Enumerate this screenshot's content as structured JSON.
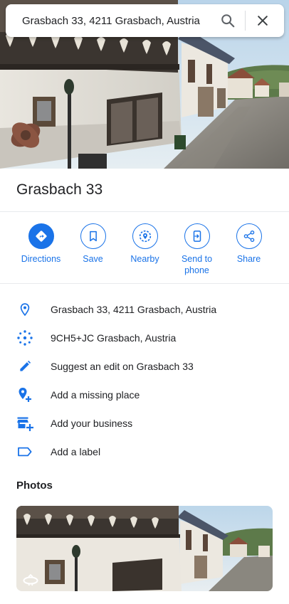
{
  "search": {
    "value": "Grasbach 33, 4211 Grasbach, Austria",
    "search_icon": "search-icon",
    "close_icon": "close-icon"
  },
  "place": {
    "title": "Grasbach 33"
  },
  "actions": [
    {
      "label": "Directions",
      "icon": "directions-icon"
    },
    {
      "label": "Save",
      "icon": "bookmark-icon"
    },
    {
      "label": "Nearby",
      "icon": "nearby-icon"
    },
    {
      "label": "Send to phone",
      "icon": "send-to-phone-icon"
    },
    {
      "label": "Share",
      "icon": "share-icon"
    }
  ],
  "info": [
    {
      "text": "Grasbach 33, 4211 Grasbach, Austria",
      "icon": "location-pin-icon"
    },
    {
      "text": "9CH5+JC Grasbach, Austria",
      "icon": "plus-code-icon"
    },
    {
      "text": "Suggest an edit on Grasbach 33",
      "icon": "pencil-icon"
    },
    {
      "text": "Add a missing place",
      "icon": "add-place-icon"
    },
    {
      "text": "Add your business",
      "icon": "add-business-icon"
    },
    {
      "text": "Add a label",
      "icon": "label-icon"
    }
  ],
  "photos": {
    "heading": "Photos"
  },
  "colors": {
    "accent": "#1a73e8",
    "text": "#202124",
    "divider": "#e8eaed"
  }
}
